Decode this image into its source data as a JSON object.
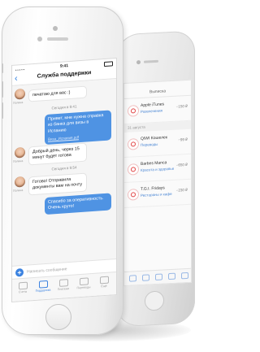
{
  "support_chat": {
    "status_time": "9:41",
    "title": "Служба поддержки",
    "messages": [
      {
        "type": "in",
        "sender": "Полина",
        "text": "печатаю для вас :)"
      },
      {
        "type": "time",
        "text": "Сегодня в 9:41"
      },
      {
        "type": "out",
        "text": "Привет, мне нужна справка из банка для визы в Испанию",
        "attachment": "Виза_Испания.pdf"
      },
      {
        "type": "in",
        "sender": "Полина",
        "text": "Добрый день, через 15 минут будет готова"
      },
      {
        "type": "time",
        "text": "Сегодня в 9:54"
      },
      {
        "type": "in",
        "sender": "Полина",
        "text": "Готово! Отправила документы вам на почту"
      },
      {
        "type": "out",
        "text": "Спасибо за оперативность. Очень круто!"
      }
    ],
    "input_placeholder": "Написать сообщение",
    "tabs": [
      "Счета",
      "Поддержка",
      "Платежи",
      "Переводы",
      "Ещё"
    ]
  },
  "back_screen": {
    "title": "Выписка",
    "items": [
      {
        "name": "Apple iTunes",
        "category": "Развлечения",
        "amount": "−150 ₽"
      },
      {
        "name": "QIWI Кошелек",
        "category": "Переводы",
        "amount": "−99 ₽"
      },
      {
        "name": "Barbes Manca",
        "category": "Красота и здоровье",
        "amount": "−650 ₽"
      },
      {
        "name": "T.G.I. Fridays",
        "category": "Рестораны и кафе",
        "amount": "−230 ₽"
      }
    ],
    "date_separator": "31 августа"
  },
  "colors": {
    "accent": "#3b82e0",
    "bubble_out": "#4f93e3",
    "chat_bg": "#f5f5f5"
  }
}
